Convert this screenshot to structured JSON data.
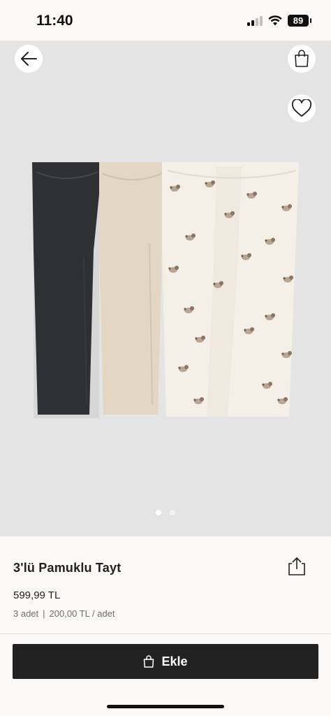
{
  "status": {
    "time": "11:40",
    "battery": "89"
  },
  "gallery": {
    "page_count": 2,
    "active_index": 0
  },
  "product": {
    "name": "3'lü Pamuklu Tayt",
    "price": "599,99 TL",
    "quantity": "3 adet",
    "separator": "|",
    "unit_price": "200,00 TL / adet"
  },
  "cart": {
    "add_label": "Ekle"
  },
  "colors": {
    "button_bg": "#222222",
    "gallery_bg": "#e4e4e4",
    "legging_dark": "#2e3034",
    "legging_beige": "#e3d7c4",
    "legging_cream": "#f4f0e8"
  },
  "icons": {
    "back": "arrow-left-icon",
    "bag": "shopping-bag-icon",
    "favorite": "heart-icon",
    "share": "share-icon",
    "add": "shopping-bag-icon"
  }
}
